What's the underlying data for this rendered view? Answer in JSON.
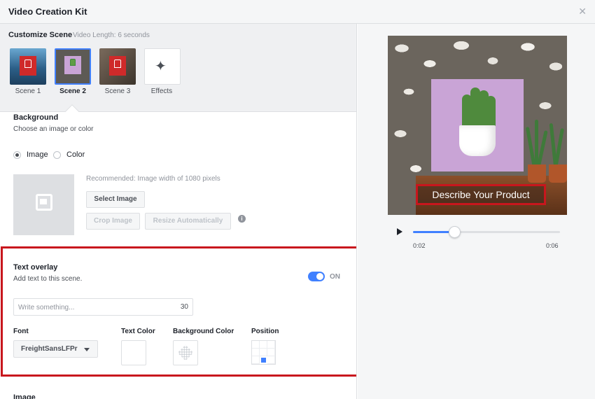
{
  "window": {
    "title": "Video Creation Kit",
    "close_icon": "✕"
  },
  "scene_header": {
    "label": "Customize Scene",
    "video_length": "Video Length: 6 seconds",
    "scenes": [
      {
        "label": "Scene 1",
        "active": false
      },
      {
        "label": "Scene 2",
        "active": true
      },
      {
        "label": "Scene 3",
        "active": false
      }
    ],
    "effects_label": "Effects",
    "effects_icon": "magic-wand-icon"
  },
  "background": {
    "title": "Background",
    "subtitle": "Choose an image or color",
    "options": [
      "Image",
      "Color"
    ],
    "selected": "Image",
    "recommendation": "Recommended: Image width of 1080 pixels",
    "select_image": "Select Image",
    "crop_image": "Crop Image",
    "resize_auto": "Resize Automatically",
    "info_glyph": "i"
  },
  "text_overlay": {
    "title": "Text overlay",
    "subtitle": "Add text to this scene.",
    "toggle_state": "ON",
    "toggle_on": true,
    "input_placeholder": "Write something...",
    "char_remaining": "30",
    "font_label": "Font",
    "font_value": "FreightSansLFPr",
    "text_color_label": "Text Color",
    "bg_color_label": "Background Color",
    "position_label": "Position",
    "position_selected": "bottom-center"
  },
  "image_section": {
    "label": "Image"
  },
  "preview": {
    "caption": "Describe Your Product",
    "time_current": "0:02",
    "time_total": "0:06",
    "progress": 0.28
  },
  "colors": {
    "accent": "#4080ff",
    "highlight": "#c8161d",
    "product_bg": "#c9a4d6"
  }
}
